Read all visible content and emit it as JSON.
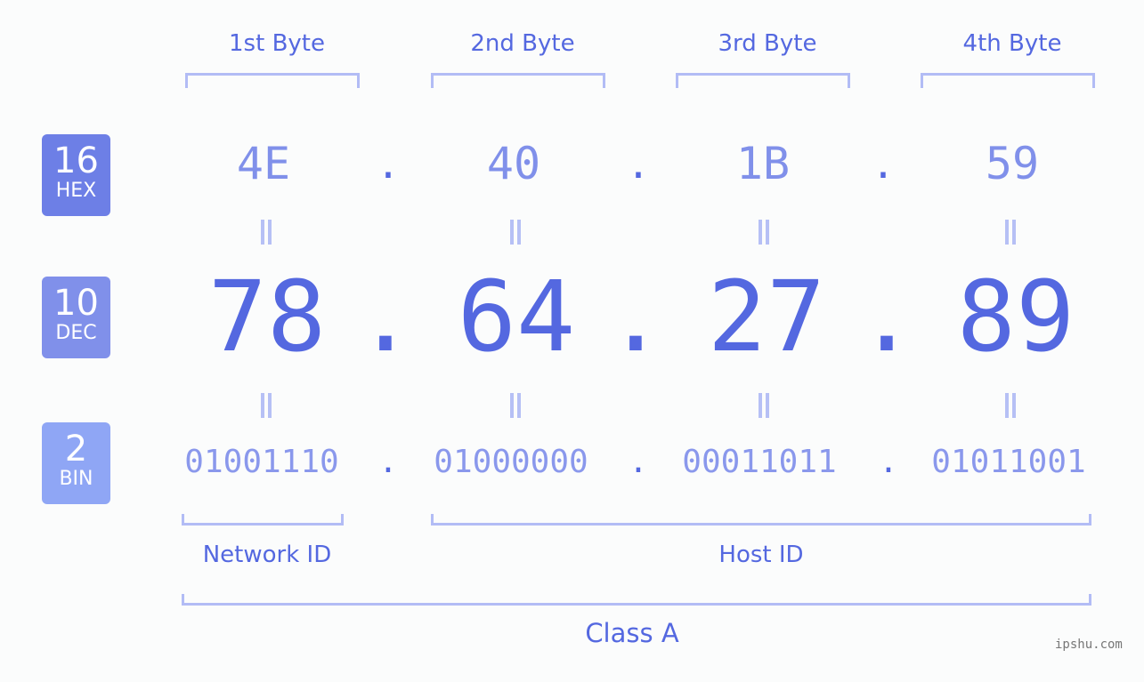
{
  "headers": [
    "1st Byte",
    "2nd Byte",
    "3rd Byte",
    "4th Byte"
  ],
  "badges": [
    {
      "number": "16",
      "label": "HEX",
      "color": "#6d7fe6"
    },
    {
      "number": "10",
      "label": "DEC",
      "color": "#8090ea"
    },
    {
      "number": "2",
      "label": "BIN",
      "color": "#8fa6f5"
    }
  ],
  "hex": [
    "4E",
    "40",
    "1B",
    "59"
  ],
  "dec": [
    "78",
    "64",
    "27",
    "89"
  ],
  "bin": [
    "01001110",
    "01000000",
    "00011011",
    "01011001"
  ],
  "separator": ".",
  "network_label": "Network ID",
  "host_label": "Host ID",
  "class_label": "Class A",
  "watermark": "ipshu.com"
}
